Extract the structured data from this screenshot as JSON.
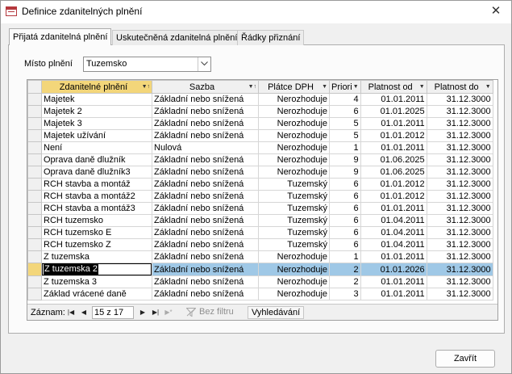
{
  "window": {
    "title": "Definice zdanitelných plnění"
  },
  "tabs": [
    {
      "label": "Přijatá zdanitelná plnění"
    },
    {
      "label": "Uskutečněná zdanitelná plnění"
    },
    {
      "label": "Řádky přiznání"
    }
  ],
  "filter": {
    "label": "Místo plnění",
    "value": "Tuzemsko"
  },
  "grid": {
    "columns": [
      "Zdanitelné plnění",
      "Sazba",
      "Plátce DPH",
      "Priori",
      "Platnost od",
      "Platnost do"
    ],
    "rows": [
      [
        "Majetek",
        "Základní nebo snížená",
        "Nerozhoduje",
        "4",
        "01.01.2011",
        "31.12.3000"
      ],
      [
        "Majetek 2",
        "Základní nebo snížená",
        "Nerozhoduje",
        "6",
        "01.01.2025",
        "31.12.3000"
      ],
      [
        "Majetek 3",
        "Základní nebo snížená",
        "Nerozhoduje",
        "5",
        "01.01.2011",
        "31.12.3000"
      ],
      [
        "Majetek užívání",
        "Základní nebo snížená",
        "Nerozhoduje",
        "5",
        "01.01.2012",
        "31.12.3000"
      ],
      [
        "Není",
        "Nulová",
        "Nerozhoduje",
        "1",
        "01.01.2011",
        "31.12.3000"
      ],
      [
        "Oprava daně dlužník",
        "Základní nebo snížená",
        "Nerozhoduje",
        "9",
        "01.06.2025",
        "31.12.3000"
      ],
      [
        "Oprava daně dlužník3",
        "Základní nebo snížená",
        "Nerozhoduje",
        "9",
        "01.06.2025",
        "31.12.3000"
      ],
      [
        "RCH stavba a montáž",
        "Základní nebo snížená",
        "Tuzemský",
        "6",
        "01.01.2012",
        "31.12.3000"
      ],
      [
        "RCH stavba a montáž2",
        "Základní nebo snížená",
        "Tuzemský",
        "6",
        "01.01.2012",
        "31.12.3000"
      ],
      [
        "RCH stavba a montáž3",
        "Základní nebo snížená",
        "Tuzemský",
        "6",
        "01.01.2011",
        "31.12.3000"
      ],
      [
        "RCH tuzemsko",
        "Základní nebo snížená",
        "Tuzemský",
        "6",
        "01.04.2011",
        "31.12.3000"
      ],
      [
        "RCH tuzemsko E",
        "Základní nebo snížená",
        "Tuzemský",
        "6",
        "01.04.2011",
        "31.12.3000"
      ],
      [
        "RCH tuzemsko Z",
        "Základní nebo snížená",
        "Tuzemský",
        "6",
        "01.04.2011",
        "31.12.3000"
      ],
      [
        "Z tuzemska",
        "Základní nebo snížená",
        "Nerozhoduje",
        "1",
        "01.01.2011",
        "31.12.3000"
      ],
      [
        "Z tuzemska 2",
        "Základní nebo snížená",
        "Nerozhoduje",
        "2",
        "01.01.2026",
        "31.12.3000"
      ],
      [
        "Z tuzemska 3",
        "Základní nebo snížená",
        "Nerozhoduje",
        "2",
        "01.01.2011",
        "31.12.3000"
      ],
      [
        "Základ vrácené daně",
        "Základní nebo snížená",
        "Nerozhoduje",
        "3",
        "01.01.2011",
        "31.12.3000"
      ]
    ],
    "current_row": 14
  },
  "navigator": {
    "label": "Záznam:",
    "position": "15 z 17",
    "filter_label": "Bez filtru",
    "search_label": "Vyhledávání"
  },
  "footer": {
    "close_label": "Zavřít"
  },
  "colors": {
    "selection": "#9fc8e6",
    "header_active": "#f3d67a",
    "app_icon": "#b5383d"
  }
}
